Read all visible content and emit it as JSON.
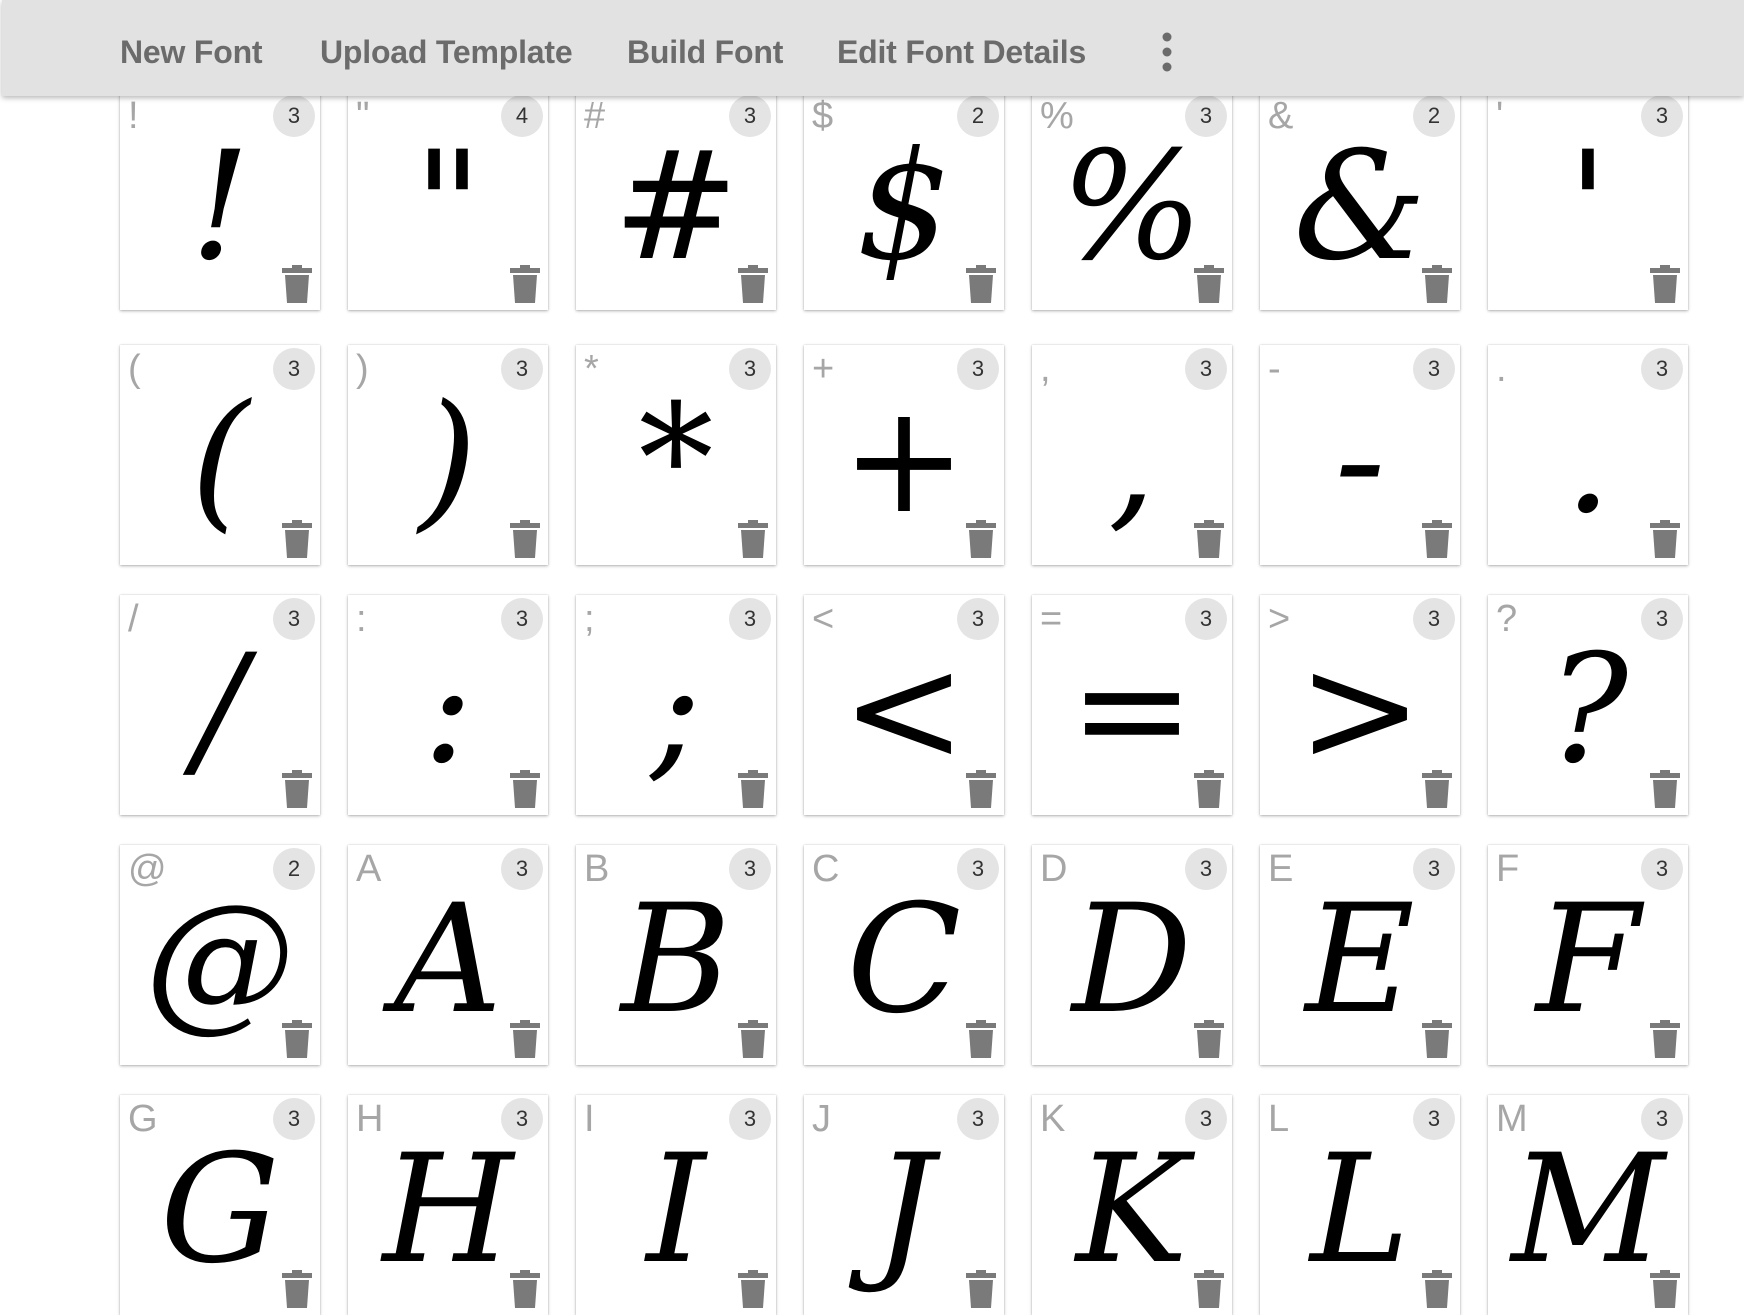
{
  "toolbar": {
    "new_font": "New Font",
    "upload_template": "Upload Template",
    "build_font": "Build Font",
    "edit_font_details": "Edit Font Details",
    "more_icon": "more-vert-icon"
  },
  "glyphs": [
    {
      "char": "!",
      "count": "3"
    },
    {
      "char": "\"",
      "count": "4"
    },
    {
      "char": "#",
      "count": "3"
    },
    {
      "char": "$",
      "count": "2"
    },
    {
      "char": "%",
      "count": "3"
    },
    {
      "char": "&",
      "count": "2"
    },
    {
      "char": "'",
      "count": "3"
    },
    {
      "char": "(",
      "count": "3"
    },
    {
      "char": ")",
      "count": "3"
    },
    {
      "char": "*",
      "count": "3"
    },
    {
      "char": "+",
      "count": "3"
    },
    {
      "char": ",",
      "count": "3"
    },
    {
      "char": "-",
      "count": "3"
    },
    {
      "char": ".",
      "count": "3"
    },
    {
      "char": "/",
      "count": "3"
    },
    {
      "char": ":",
      "count": "3"
    },
    {
      "char": ";",
      "count": "3"
    },
    {
      "char": "<",
      "count": "3"
    },
    {
      "char": "=",
      "count": "3"
    },
    {
      "char": ">",
      "count": "3"
    },
    {
      "char": "?",
      "count": "3"
    },
    {
      "char": "@",
      "count": "2"
    },
    {
      "char": "A",
      "count": "3"
    },
    {
      "char": "B",
      "count": "3"
    },
    {
      "char": "C",
      "count": "3"
    },
    {
      "char": "D",
      "count": "3"
    },
    {
      "char": "E",
      "count": "3"
    },
    {
      "char": "F",
      "count": "3"
    },
    {
      "char": "G",
      "count": "3"
    },
    {
      "char": "H",
      "count": "3"
    },
    {
      "char": "I",
      "count": "3"
    },
    {
      "char": "J",
      "count": "3"
    },
    {
      "char": "K",
      "count": "3"
    },
    {
      "char": "L",
      "count": "3"
    },
    {
      "char": "M",
      "count": "3"
    }
  ],
  "icons": {
    "delete": "trash-icon"
  },
  "colors": {
    "toolbar_bg": "#e2e2e2",
    "toolbar_text": "#6b6b6b",
    "badge_bg": "#e4e4e4",
    "trash": "#7a7a7a"
  }
}
